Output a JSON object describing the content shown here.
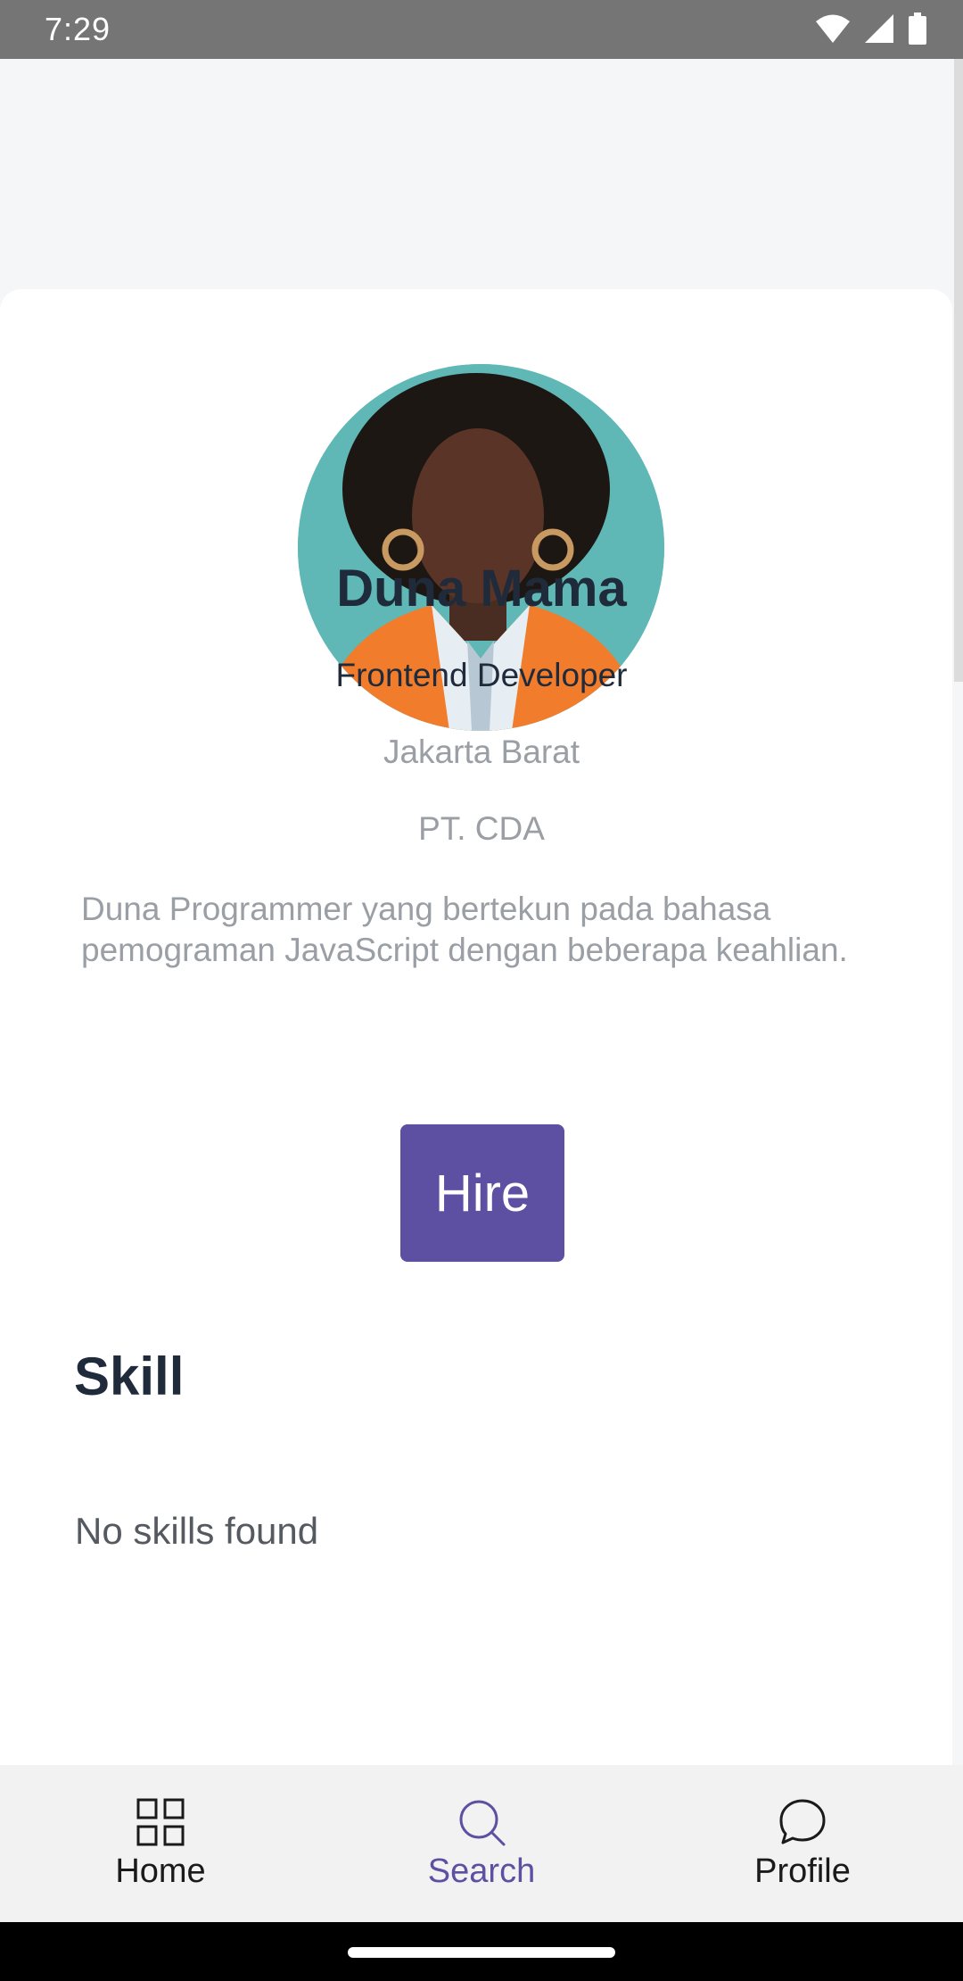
{
  "status_bar": {
    "time": "7:29",
    "icons": [
      "wifi-icon",
      "signal-icon",
      "battery-icon"
    ]
  },
  "profile": {
    "name": "Duna Mama",
    "job_title": "Frontend Developer",
    "location": "Jakarta Barat",
    "company": "PT. CDA",
    "bio": "Duna Programmer yang bertekun pada bahasa pemograman JavaScript dengan beberapa keahlian."
  },
  "actions": {
    "hire_label": "Hire"
  },
  "skills": {
    "title": "Skill",
    "empty_text": "No skills found"
  },
  "bottom_nav": {
    "items": [
      {
        "label": "Home",
        "icon": "grid-icon",
        "active": false
      },
      {
        "label": "Search",
        "icon": "search-icon",
        "active": true
      },
      {
        "label": "Profile",
        "icon": "chat-bubble-icon",
        "active": false
      }
    ]
  },
  "colors": {
    "accent": "#5d4fa1",
    "heading": "#1f2a3a",
    "muted": "#9a9ea5",
    "avatar_bg": "#5fb8b6"
  }
}
